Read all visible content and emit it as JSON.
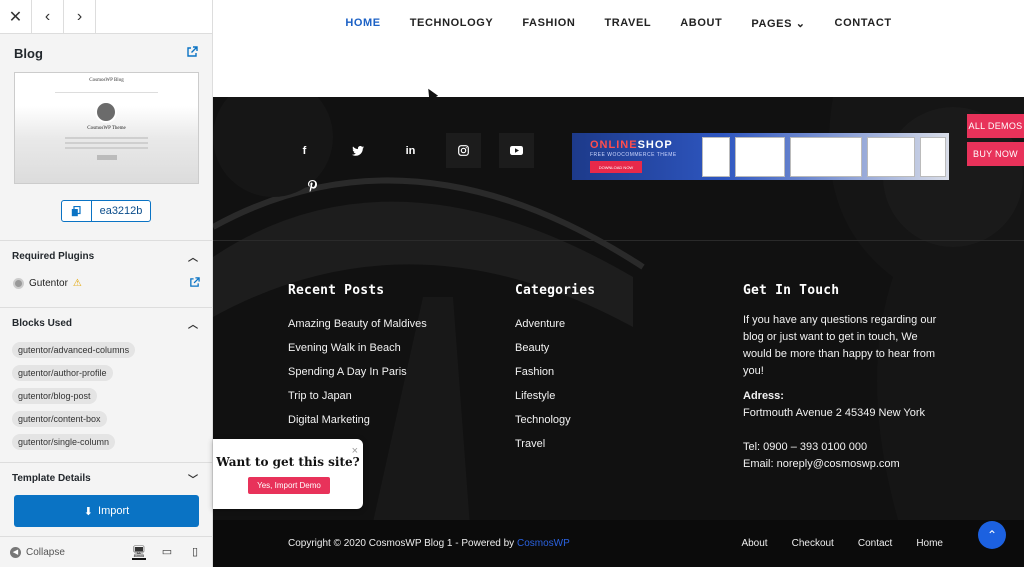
{
  "sidebar": {
    "nav": {
      "close": "✕",
      "back": "‹",
      "forward": "›"
    },
    "title": "Blog",
    "preview": {
      "site_title": "CosmosWP Blog",
      "author": "CosmosWP Theme"
    },
    "hash_code": "ea3212b",
    "required_plugins": {
      "heading": "Required Plugins",
      "items": [
        {
          "name": "Gutentor",
          "warning": "⚠"
        }
      ]
    },
    "blocks_used": {
      "heading": "Blocks Used",
      "items": [
        "gutentor/advanced-columns",
        "gutentor/author-profile",
        "gutentor/blog-post",
        "gutentor/content-box",
        "gutentor/single-column"
      ]
    },
    "template_details": "Template Details",
    "import_label": "Import",
    "collapse_label": "Collapse"
  },
  "nav": {
    "items": [
      "HOME",
      "TECHNOLOGY",
      "FASHION",
      "TRAVEL",
      "ABOUT",
      "PAGES",
      "CONTACT"
    ],
    "active": "HOME"
  },
  "social": [
    "f",
    "t",
    "in",
    "ig",
    "yt",
    "p"
  ],
  "banner": {
    "brand_a": "ONLINE",
    "brand_b": "SHOP",
    "sub": "FREE WOOCOMMERCE THEME",
    "button": "DOWNLOAD NOW"
  },
  "footer": {
    "recent_posts": {
      "heading": "Recent Posts",
      "items": [
        "Amazing Beauty of Maldives",
        "Evening Walk in Beach",
        "Spending A Day In Paris",
        "Trip to Japan",
        "Digital Marketing"
      ]
    },
    "categories": {
      "heading": "Categories",
      "items": [
        "Adventure",
        "Beauty",
        "Fashion",
        "Lifestyle",
        "Technology",
        "Travel"
      ]
    },
    "touch": {
      "heading": "Get In Touch",
      "text": "If you have any questions regarding our blog or just want to get in touch, We would be more than happy to hear from you!",
      "address_label": "Adress:",
      "address": "Fortmouth Avenue 2 45349 New York",
      "tel": "Tel: 0900 – 393 0100 000",
      "email": "Email: noreply@cosmoswp.com"
    },
    "copyright": "Copyright © 2020 CosmosWP Blog 1 - Powered by",
    "powered_link": "CosmosWP",
    "links": [
      "About",
      "Checkout",
      "Contact",
      "Home"
    ]
  },
  "side_buttons": {
    "all_demos": "ALL DEMOS",
    "buy_now": "BUY NOW"
  },
  "popup": {
    "title": "Want to get this site?",
    "button": "Yes, Import Demo",
    "close": "×"
  },
  "colors": {
    "accent": "#0a73c4",
    "pink": "#e8325a",
    "nav_active": "#1c61c5"
  }
}
